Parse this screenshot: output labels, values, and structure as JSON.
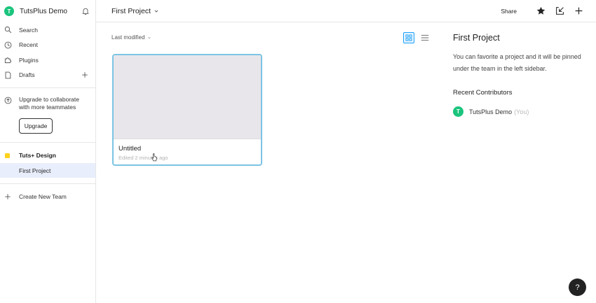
{
  "sidebar": {
    "team_avatar": "T",
    "team_name": "TutsPlus Demo",
    "nav": [
      {
        "label": "Search",
        "icon": "search-icon"
      },
      {
        "label": "Recent",
        "icon": "clock-icon"
      },
      {
        "label": "Plugins",
        "icon": "plugin-icon"
      },
      {
        "label": "Drafts",
        "icon": "file-icon"
      }
    ],
    "upgrade_text": "Upgrade to collaborate with more teammates",
    "upgrade_button": "Upgrade",
    "team_item": "Tuts+ Design",
    "project_item": "First Project",
    "create_team": "Create New Team"
  },
  "header": {
    "project_title": "First Project",
    "share_label": "Share"
  },
  "main": {
    "sort_label": "Last modified",
    "file": {
      "name": "Untitled",
      "meta": "Edited 2 minutes ago"
    }
  },
  "panel": {
    "title": "First Project",
    "description": "You can favorite a project and it will be pinned under the team in the left sidebar.",
    "contributors_title": "Recent Contributors",
    "contributor": {
      "avatar": "T",
      "name": "TutsPlus Demo",
      "you": "(You)"
    }
  },
  "help_label": "?",
  "colors": {
    "accent": "#18a0fb",
    "avatar": "#1bc47d",
    "team_dot": "#ffd21e",
    "selected_bg": "#e8eefb"
  }
}
